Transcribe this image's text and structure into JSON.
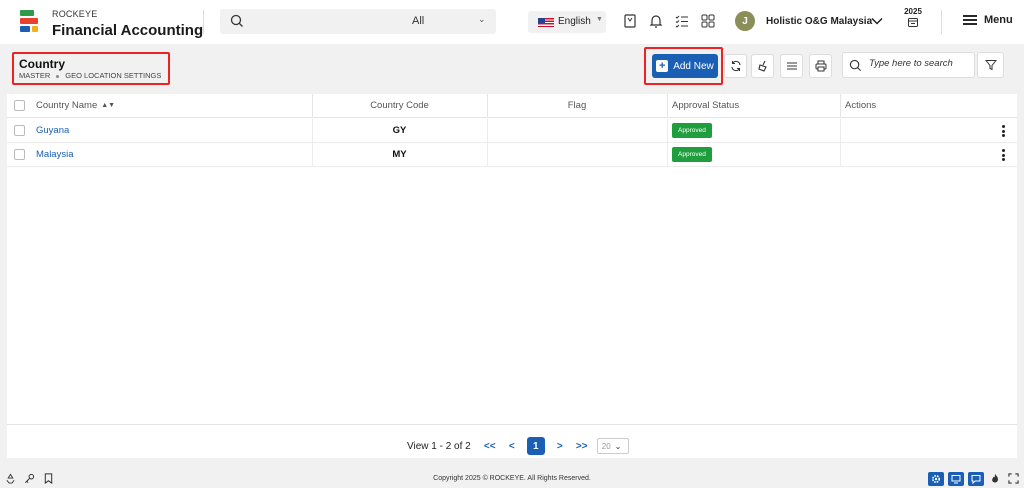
{
  "app": {
    "brand_small": "ROCKEYE",
    "brand_name": "Financial Accounting"
  },
  "header": {
    "search_placeholder": "",
    "search_scope": "All",
    "language": "English",
    "user_initial": "J",
    "organization": "Holistic O&G Malaysia",
    "year": "2025",
    "menu_label": "Menu"
  },
  "page": {
    "title": "Country",
    "breadcrumb": [
      "MASTER",
      "GEO LOCATION SETTINGS"
    ],
    "add_new_label": "Add New",
    "search_placeholder": "Type here to search"
  },
  "grid": {
    "columns": [
      "Country Name",
      "Country Code",
      "Flag",
      "Approval Status",
      "Actions"
    ],
    "rows": [
      {
        "name": "Guyana",
        "code": "GY",
        "flag": "",
        "status": "Approved"
      },
      {
        "name": "Malaysia",
        "code": "MY",
        "flag": "",
        "status": "Approved"
      }
    ]
  },
  "pager": {
    "summary": "View 1 - 2 of 2",
    "current_page": "1",
    "page_size": "20",
    "first": "<<",
    "prev": "<",
    "next": ">",
    "last": ">>"
  },
  "footer": {
    "copyright": "Copyright 2025 © ROCKEYE. All Rights Reserved."
  },
  "colors": {
    "primary": "#1a5fb4",
    "approved": "#1e9e3c",
    "highlight": "#e22222"
  }
}
